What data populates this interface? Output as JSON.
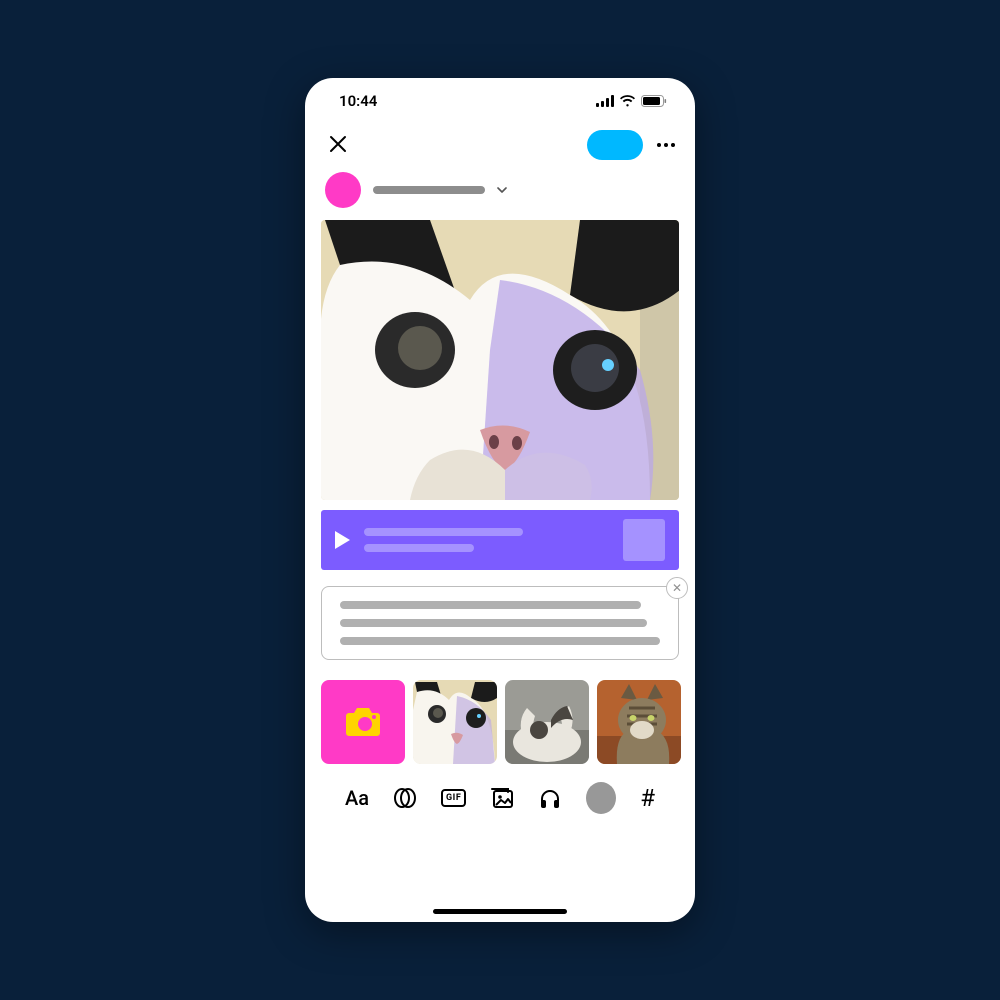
{
  "status": {
    "time": "10:44"
  },
  "header": {
    "close": "close",
    "post_label": "",
    "more": "more"
  },
  "user": {
    "name_placeholder": ""
  },
  "audio": {
    "title_placeholder": "",
    "subtitle_placeholder": ""
  },
  "caption": {
    "line1": "",
    "line2": "",
    "line3": "",
    "close_label": "✕"
  },
  "gallery": {
    "camera_label": "camera",
    "thumb1": "cat-bw-closeup",
    "thumb2": "cat-stretch-couch",
    "thumb3": "cat-tabby-sit"
  },
  "toolbar": {
    "text": "Aa",
    "link": "link",
    "gif": "GIF",
    "image": "image",
    "audio": "audio",
    "misc": "",
    "tag": "#"
  },
  "colors": {
    "bg": "#09203a",
    "accent": "#00b8ff",
    "avatar": "#ff3ac6",
    "audio": "#7c5cff",
    "audio_light": "#a592ff",
    "camera": "#ff3ac6"
  }
}
